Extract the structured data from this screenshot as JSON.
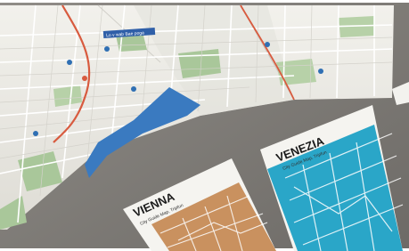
{
  "map_labels": {
    "banner": "Lo v wab Bae poga"
  },
  "vienna": {
    "title": "VIENNA",
    "subtitle": "City Guide Map, Tripfun",
    "color": "#c9915f"
  },
  "venezia": {
    "title": "VENEZIA",
    "subtitle": "City Guide Map, Tripfun",
    "color": "#2aa6c8"
  },
  "colors": {
    "table": "#7b7873",
    "paper": "#ecebe6",
    "park": "#a9c79a",
    "water": "#3a7ac0",
    "road_red": "#d85b3f"
  }
}
